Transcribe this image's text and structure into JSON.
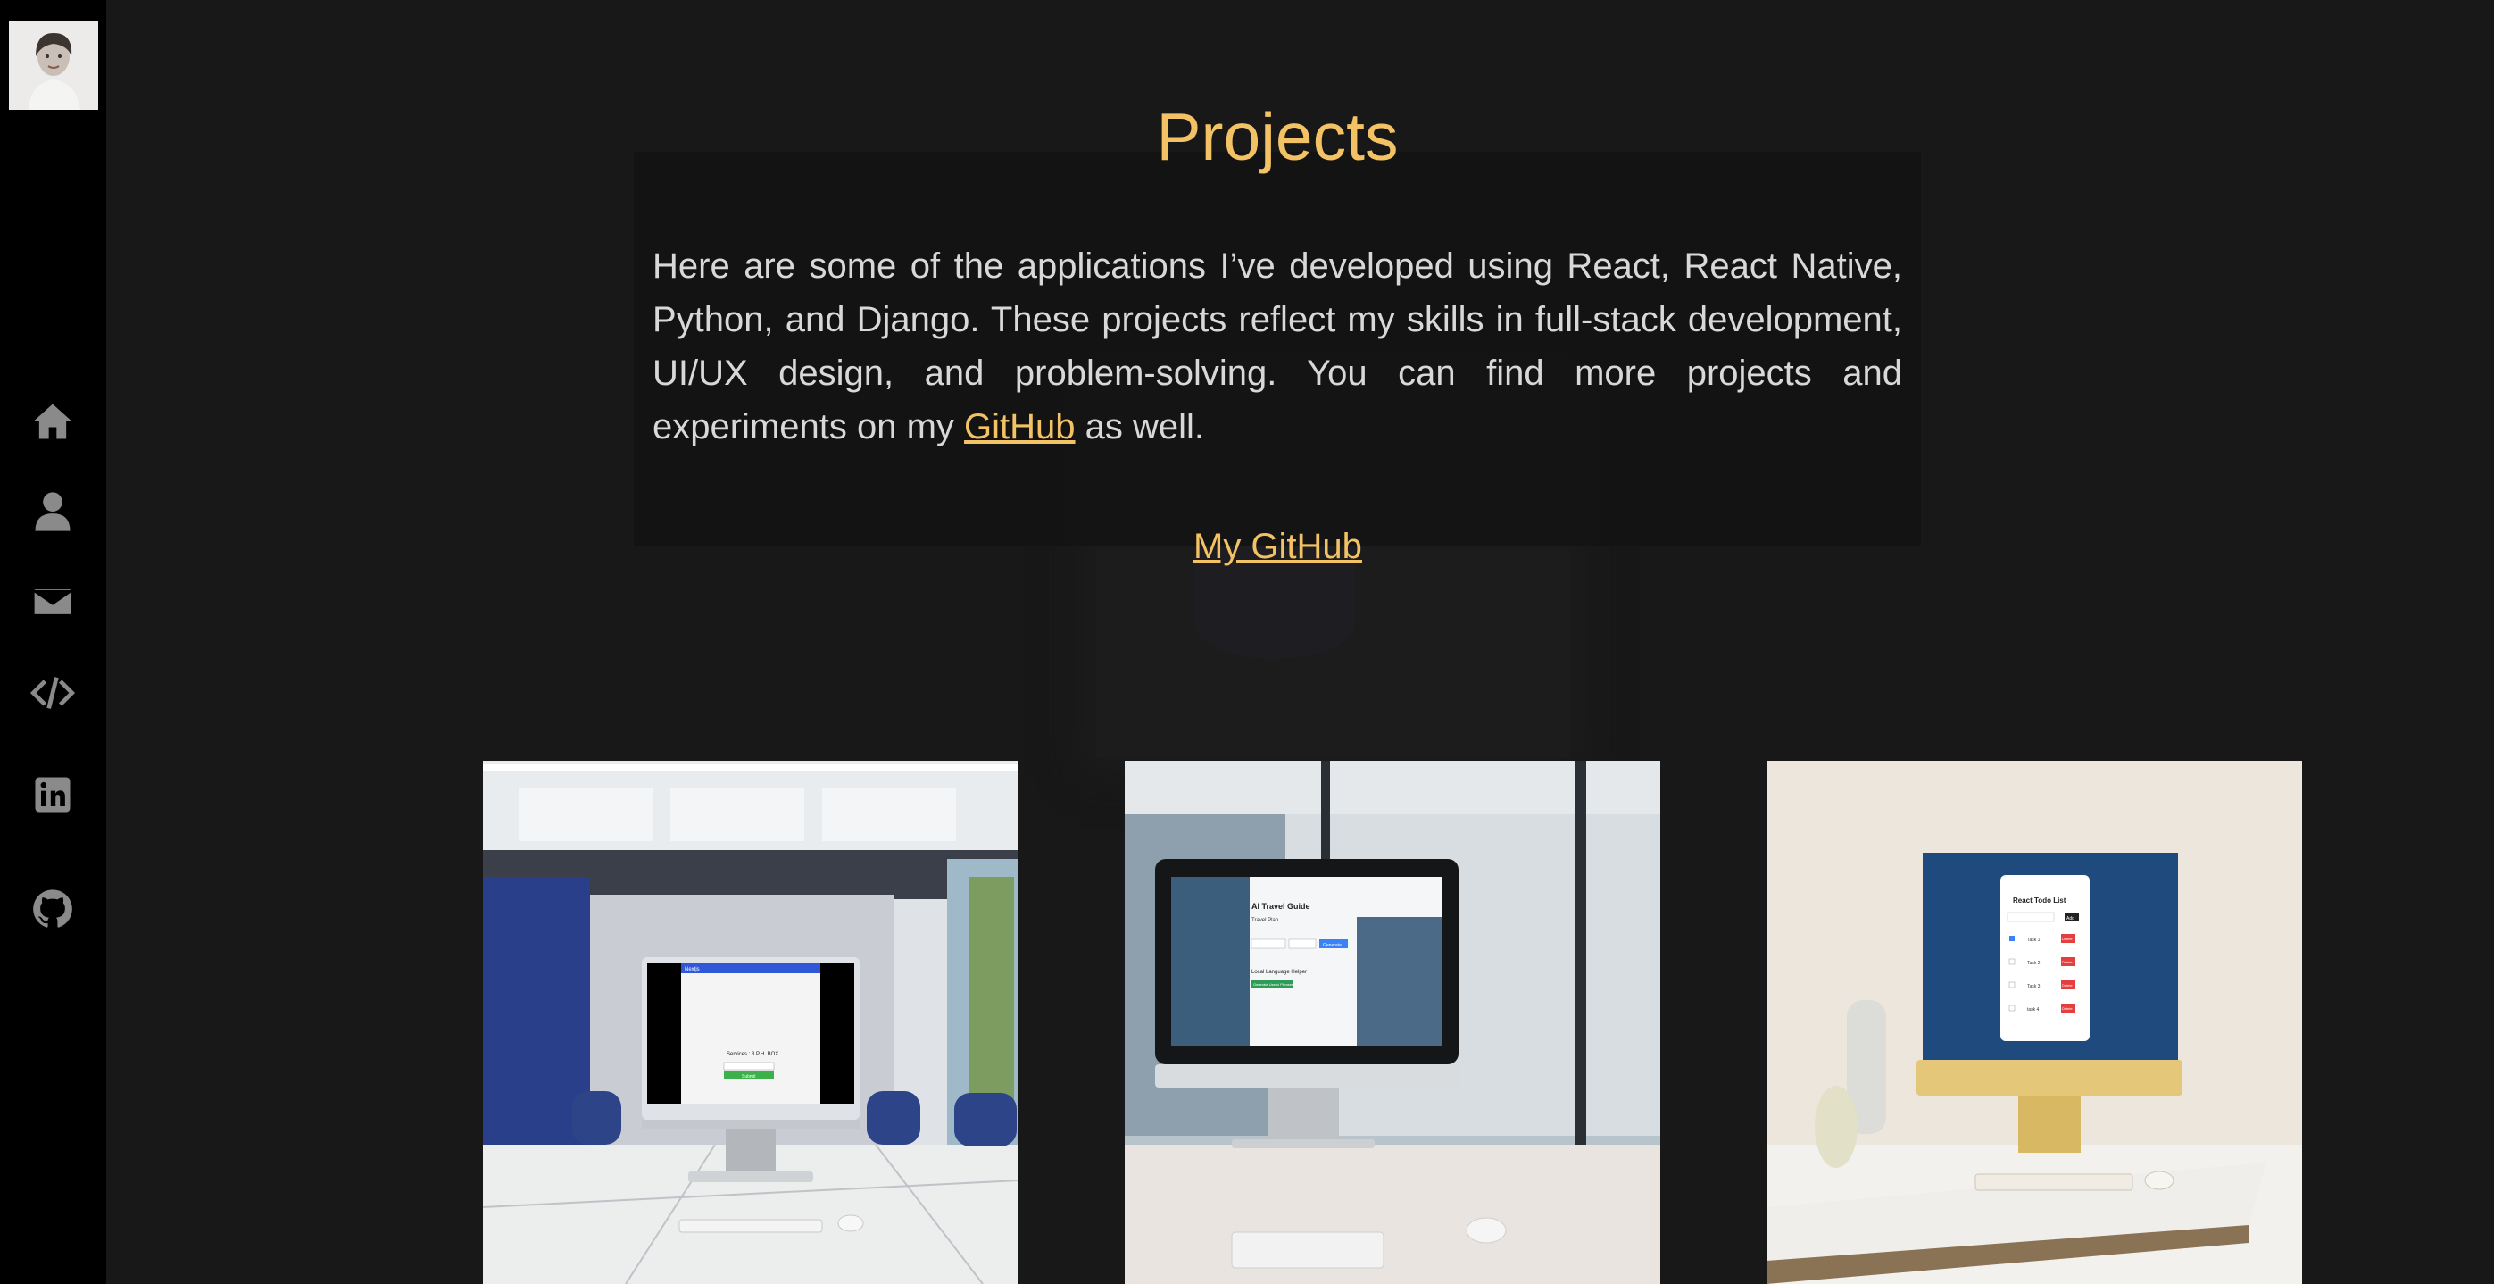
{
  "sidebar": {
    "avatar_alt": "profile photo",
    "items": [
      {
        "icon": "home-icon"
      },
      {
        "icon": "user-icon"
      },
      {
        "icon": "envelope-icon"
      },
      {
        "icon": "code-icon"
      },
      {
        "icon": "linkedin-icon"
      },
      {
        "icon": "github-icon"
      }
    ]
  },
  "projects_section": {
    "title": "Projects",
    "description_before": "Here are some of the applications I’ve developed using React, React Native, Python, and Django. These projects reflect my skills in full-stack development, UI/UX design, and problem-solving. You can find more projects and experiments on my ",
    "description_link": "GitHub",
    "description_after": " as well.",
    "github_button": "My GitHub"
  },
  "projects": [
    {
      "name": "project-1",
      "screen_title": "Nextjs",
      "screen_heading": "Services : 3 P.H. BOX",
      "screen_button": "Submit"
    },
    {
      "name": "project-2",
      "screen_title": "AI Travel Guide",
      "screen_subtitle": "Travel Plan",
      "screen_button": "Generate",
      "screen_section": "Local Language Helper",
      "screen_green_button": "Generate Useful Phrases"
    },
    {
      "name": "project-3",
      "screen_title": "React Todo List",
      "screen_add": "Add",
      "tasks": [
        "Task 1",
        "Task 2",
        "Task 3",
        "task 4"
      ],
      "delete_label": "Delete"
    }
  ],
  "colors": {
    "accent": "#f3c264",
    "background": "#181818",
    "sidebar": "#000000",
    "text": "#d8d8d8"
  }
}
